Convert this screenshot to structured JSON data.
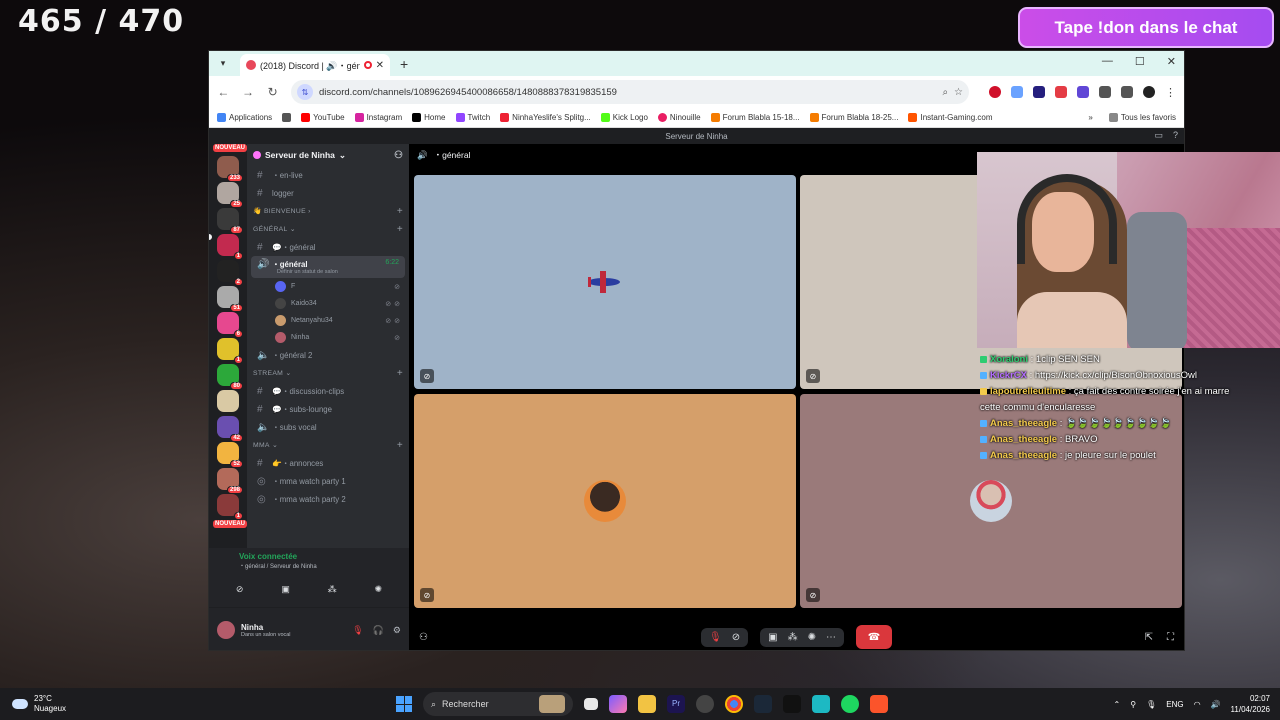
{
  "overlay": {
    "counter": "465 / 470",
    "don_banner": "Tape !don dans le chat"
  },
  "browser": {
    "tab_title": "(2018) Discord | 🔊・généra",
    "url": "discord.com/channels/1089626945400086658/1480888378319835159",
    "bookmarks": [
      "Applications",
      "YouTube",
      "Instagram",
      "Home",
      "Twitch",
      "NinhaYeslife's Splitg...",
      "Kick Logo",
      "Ninouille",
      "Forum Blabla 15-18...",
      "Forum Blabla 18-25...",
      "Instant-Gaming.com"
    ],
    "bookmarks_right": "Tous les favoris"
  },
  "discord": {
    "window_title": "Serveur de Ninha",
    "server_name": "Serveur de Ninha",
    "channels_top": [
      {
        "name": "・en-live",
        "icon": "#"
      },
      {
        "name": "logger",
        "icon": "#"
      }
    ],
    "cat_bienvenue": "👋 BIENVENUE",
    "cat_general": "GÉNÉRAL",
    "ch_general_text": "💬・général",
    "ch_general_voice": "・général",
    "ch_general_voice_sub": "Définir un statut de salon",
    "ch_general_voice_time": "6:22",
    "voice_users": [
      "F",
      "Kaido34",
      "Netanyahu34",
      "Ninha"
    ],
    "ch_general2": "・général 2",
    "cat_stream": "STREAM",
    "stream_channels": [
      "💬・discussion-clips",
      "💬・subs-lounge",
      "・subs vocal"
    ],
    "cat_mma": "MMA",
    "mma_channels": [
      "👉・annonces",
      "・mma watch party 1",
      "・mma watch party 2"
    ],
    "voice_connected": "Voix connectée",
    "voice_location": "・général / Serveur de Ninha",
    "user_name": "Ninha",
    "user_status": "Dans un salon vocal",
    "stage_channel": "・général",
    "guild_badges": [
      "233",
      "25",
      "87",
      "1",
      "2",
      "51",
      "6",
      "1",
      "80",
      "42",
      "52",
      "298",
      "1"
    ],
    "nouveau_label": "NOUVEAU"
  },
  "chat": {
    "lines": [
      {
        "who": "Xoraloni",
        "color": "#2ecc71",
        "text": " : 1clip SEN SEN"
      },
      {
        "who": "KickrCX",
        "color": "#b46cff",
        "text": " : https://kick.cx/clip/BisonObnoxiousOwl"
      },
      {
        "who": "lapoutrelleultime",
        "color": "#f2c94c",
        "text": " : ça fait des contre soirée j'en ai marre cette commu d'encularesse"
      },
      {
        "who": "Anas_theeagle",
        "color": "#f2c94c",
        "text": " : 🍃🍃🍃🍃🍃🍃🍃🍃🍃"
      },
      {
        "who": "Anas_theeagle",
        "color": "#f2c94c",
        "text": " : BRAVO"
      },
      {
        "who": "Anas_theeagle",
        "color": "#f2c94c",
        "text": " : je pleure sur le poulet"
      }
    ]
  },
  "taskbar": {
    "temp": "23°C",
    "weather": "Nuageux",
    "search_placeholder": "Rechercher",
    "lang": "ENG",
    "time": "02:07",
    "date": "11/04/2026"
  }
}
